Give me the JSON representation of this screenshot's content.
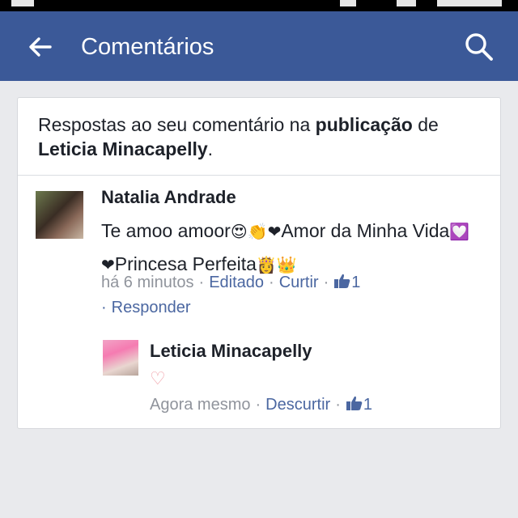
{
  "appbar": {
    "title": "Comentários",
    "back_icon": "arrow-left-icon",
    "search_icon": "search-icon"
  },
  "card": {
    "header_prefix": "Respostas ao seu comentário na ",
    "header_bold": "publicação",
    "header_mid": " de",
    "header_user": "Leticia Minacapelly",
    "header_end": "."
  },
  "comment": {
    "author": "Natalia Andrade",
    "text_a": "Te amoo amoor",
    "emoji_a": "😍👏❤",
    "text_b": "Amor da Minha Vida",
    "emoji_b": "💟❤",
    "text_c": "Princesa Perfeita",
    "emoji_c": "👸👑",
    "time": "há 6 minutos",
    "edited": "Editado",
    "like": "Curtir",
    "like_count": "1",
    "reply": "Responder"
  },
  "reply": {
    "author": "Leticia Minacapelly",
    "text": "♡",
    "time": "Agora mesmo",
    "unlike": "Descurtir",
    "like_count": "1"
  },
  "colors": {
    "appbar": "#3b5998",
    "link": "#4b67a1",
    "muted": "#90949c",
    "background": "#e9eaed"
  }
}
